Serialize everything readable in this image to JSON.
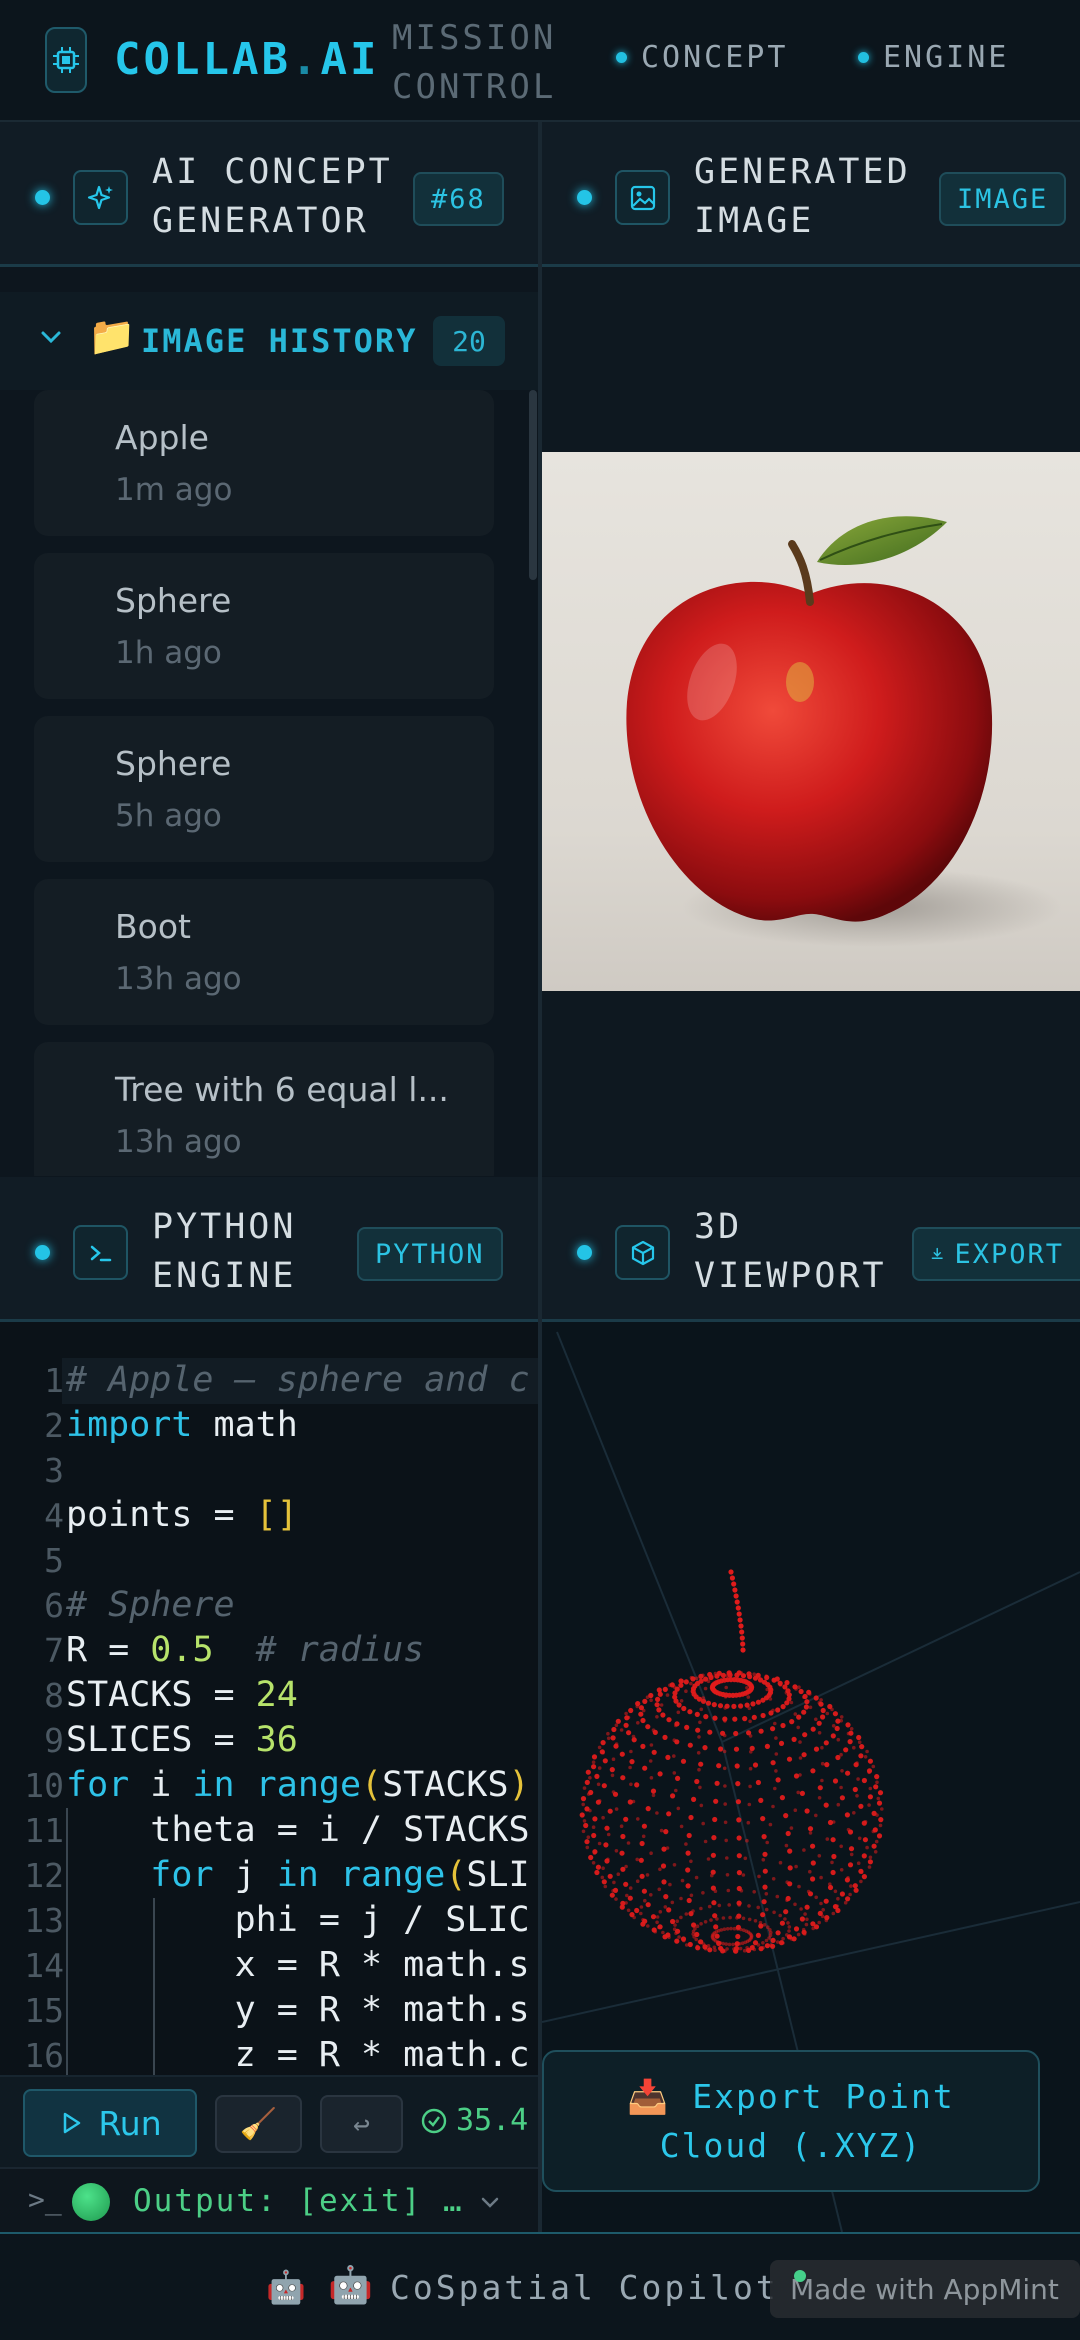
{
  "app": {
    "brand_main": "COLLAB",
    "brand_dot": ".",
    "brand_suffix": "AI",
    "mission_line1": "MISSION",
    "mission_line2": "CONTROL",
    "nav": [
      "CONCEPT",
      "ENGINE"
    ]
  },
  "concept_panel": {
    "title_line1": "AI CONCEPT",
    "title_line2": "GENERATOR",
    "badge": "#68",
    "history_label": "IMAGE HISTORY",
    "history_count": "20",
    "history": [
      {
        "name": "Apple",
        "time": "1m ago"
      },
      {
        "name": "Sphere",
        "time": "1h ago"
      },
      {
        "name": "Sphere",
        "time": "5h ago"
      },
      {
        "name": "Boot",
        "time": "13h ago"
      },
      {
        "name": "Tree with 6 equal l...",
        "time": "13h ago"
      }
    ]
  },
  "image_panel": {
    "title_line1": "GENERATED",
    "title_line2": "IMAGE",
    "badge": "IMAGE"
  },
  "python_panel": {
    "title_line1": "PYTHON",
    "title_line2": "ENGINE",
    "badge": "PYTHON",
    "line_numbers": [
      "1",
      "2",
      "3",
      "4",
      "5",
      "6",
      "7",
      "8",
      "9",
      "10",
      "11",
      "12",
      "13",
      "14",
      "15",
      "16"
    ],
    "code": {
      "l1": "# Apple — sphere and c",
      "l2_kw": "import",
      "l2_rest": " math",
      "l4_a": "points = ",
      "l4_b": "[]",
      "l6": "# Sphere",
      "l7_a": "R = ",
      "l7_b": "0.5",
      "l7_c": "  # radius",
      "l8_a": "STACKS = ",
      "l8_b": "24",
      "l9_a": "SLICES = ",
      "l9_b": "36",
      "l10_a": "for",
      "l10_b": " i ",
      "l10_c": "in",
      "l10_d": " ",
      "l10_e": "range",
      "l10_f": "(",
      "l10_g": "STACKS",
      "l10_h": ")",
      "l11": "    theta = i / STACKS",
      "l12_a": "    ",
      "l12_b": "for",
      "l12_c": " j ",
      "l12_d": "in",
      "l12_e": " ",
      "l12_f": "range",
      "l12_g": "(",
      "l12_h": "SLI",
      "l13": "        phi = j / SLIC",
      "l14": "        x = R * math.s",
      "l15": "        y = R * math.s",
      "l16": "        z = R * math.c"
    },
    "run_label": "Run",
    "broom": "🧹",
    "wrap": "↩",
    "timer": "35.4",
    "output_label": "Output: [exit] …"
  },
  "viewport_panel": {
    "title_line1": "3D",
    "title_line2": "VIEWPORT",
    "export_badge": "EXPORT",
    "export_big_line1": "📥 Export Point",
    "export_big_line2": "Cloud (.XYZ)"
  },
  "footer": {
    "bot_icon1": "🤖",
    "bot_icon2": "🤖",
    "label": "CoSpatial Copilot",
    "made_with": "Made with AppMint"
  },
  "colors": {
    "accent": "#26c6ea",
    "background": "#0d161e",
    "success": "#4ccf86",
    "point_cloud": "#e01b1b"
  }
}
